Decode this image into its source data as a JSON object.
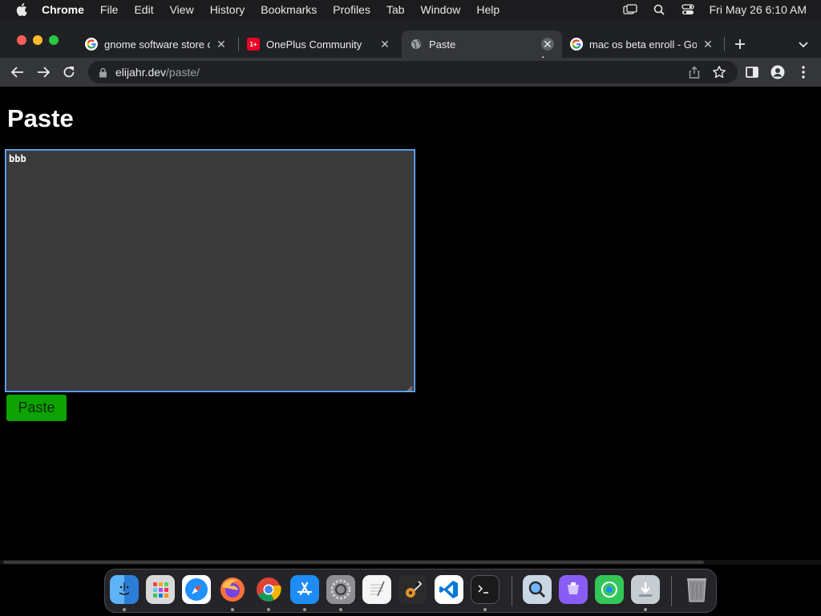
{
  "menubar": {
    "app_name": "Chrome",
    "items": [
      "File",
      "Edit",
      "View",
      "History",
      "Bookmarks",
      "Profiles",
      "Tab",
      "Window",
      "Help"
    ],
    "clock": "Fri May 26  6:10 AM"
  },
  "tabs": [
    {
      "title": "gnome software store o",
      "favicon": "google-icon"
    },
    {
      "title": "OnePlus Community",
      "favicon": "oneplus-icon"
    },
    {
      "title": "Paste",
      "favicon": "globe-icon",
      "active": true
    },
    {
      "title": "mac os beta enroll - Goo",
      "favicon": "google-icon"
    }
  ],
  "omnibox": {
    "host": "elijahr.dev",
    "path": "/paste/"
  },
  "page": {
    "heading": "Paste",
    "textarea_value": "bbb",
    "button_label": "Paste"
  },
  "colors": {
    "button_bg": "#0ca300",
    "textarea_bg": "#3b3b3b",
    "focus_ring": "#7ab8ff"
  },
  "dock": {
    "apps": [
      "Finder",
      "Launchpad",
      "Safari",
      "Firefox",
      "Chrome",
      "App Store",
      "System Preferences",
      "TextEdit",
      "GarageBand",
      "Visual Studio Code",
      "Terminal",
      "Preview",
      "Podcasts",
      "Find My",
      "Downloads",
      "Trash"
    ]
  }
}
